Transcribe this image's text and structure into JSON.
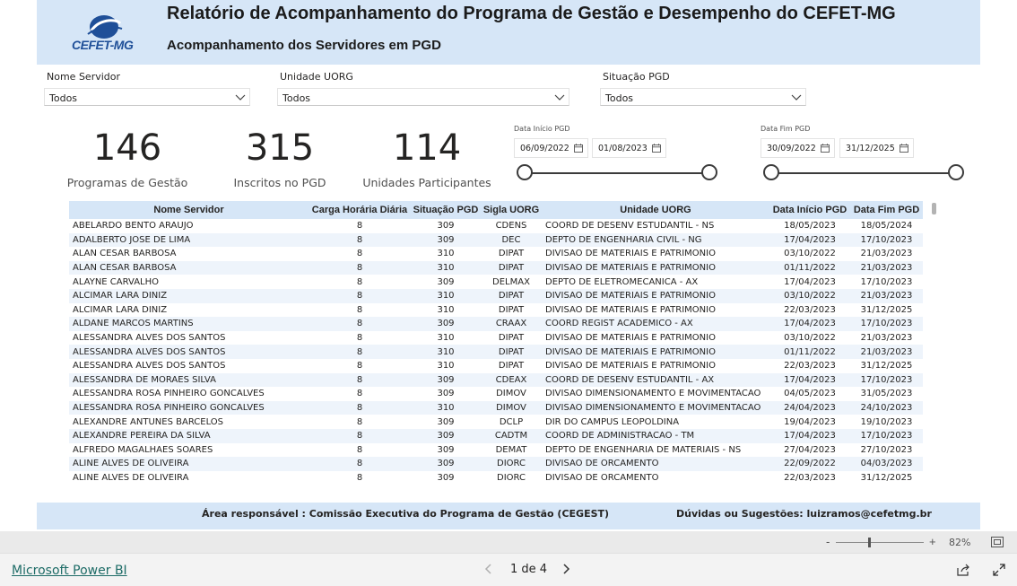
{
  "header": {
    "logo_text": "CEFET-MG",
    "title": "Relatório de Acompanhamento do Programa de Gestão e Desempenho do CEFET-MG",
    "subtitle": "Acompanhamento dos Servidores em PGD",
    "band_color": "#d6e6f7",
    "logo_color": "#1f4f98"
  },
  "filters": [
    {
      "label": "Nome Servidor",
      "value": "Todos"
    },
    {
      "label": "Unidade UORG",
      "value": "Todos"
    },
    {
      "label": "Situação PGD",
      "value": "Todos"
    }
  ],
  "kpis": [
    {
      "value": "146",
      "label": "Programas de Gestão"
    },
    {
      "value": "315",
      "label": "Inscritos no PGD"
    },
    {
      "value": "114",
      "label": "Unidades Participantes"
    }
  ],
  "date_filters": {
    "inicio": {
      "label": "Data Início PGD",
      "from": "06/09/2022",
      "to": "01/08/2023"
    },
    "fim": {
      "label": "Data Fim PGD",
      "from": "30/09/2022",
      "to": "31/12/2025"
    }
  },
  "table": {
    "columns": [
      "Nome Servidor",
      "Carga Horária Diária",
      "Situação PGD",
      "Sigla UORG",
      "Unidade UORG",
      "Data Início PGD",
      "Data Fim PGD"
    ],
    "rows": [
      [
        "ABELARDO BENTO ARAUJO",
        "8",
        "309",
        "CDENS",
        "COORD DE DESENV ESTUDANTIL - NS",
        "18/05/2023",
        "18/05/2024"
      ],
      [
        "ADALBERTO JOSE DE LIMA",
        "8",
        "309",
        "DEC",
        "DEPTO DE ENGENHARIA CIVIL - NG",
        "17/04/2023",
        "17/10/2023"
      ],
      [
        "ALAN CESAR BARBOSA",
        "8",
        "310",
        "DIPAT",
        "DIVISAO DE MATERIAIS E PATRIMONIO",
        "03/10/2022",
        "21/03/2023"
      ],
      [
        "ALAN CESAR BARBOSA",
        "8",
        "310",
        "DIPAT",
        "DIVISAO DE MATERIAIS E PATRIMONIO",
        "01/11/2022",
        "21/03/2023"
      ],
      [
        "ALAYNE CARVALHO",
        "8",
        "309",
        "DELMAX",
        "DEPTO DE ELETROMECANICA - AX",
        "17/04/2023",
        "17/10/2023"
      ],
      [
        "ALCIMAR LARA DINIZ",
        "8",
        "310",
        "DIPAT",
        "DIVISAO DE MATERIAIS E PATRIMONIO",
        "03/10/2022",
        "21/03/2023"
      ],
      [
        "ALCIMAR LARA DINIZ",
        "8",
        "310",
        "DIPAT",
        "DIVISAO DE MATERIAIS E PATRIMONIO",
        "22/03/2023",
        "31/12/2025"
      ],
      [
        "ALDANE MARCOS MARTINS",
        "8",
        "309",
        "CRAAX",
        "COORD REGIST ACADEMICO - AX",
        "17/04/2023",
        "17/10/2023"
      ],
      [
        "ALESSANDRA ALVES DOS SANTOS",
        "8",
        "310",
        "DIPAT",
        "DIVISAO DE MATERIAIS E PATRIMONIO",
        "03/10/2022",
        "21/03/2023"
      ],
      [
        "ALESSANDRA ALVES DOS SANTOS",
        "8",
        "310",
        "DIPAT",
        "DIVISAO DE MATERIAIS E PATRIMONIO",
        "01/11/2022",
        "21/03/2023"
      ],
      [
        "ALESSANDRA ALVES DOS SANTOS",
        "8",
        "310",
        "DIPAT",
        "DIVISAO DE MATERIAIS E PATRIMONIO",
        "22/03/2023",
        "31/12/2025"
      ],
      [
        "ALESSANDRA DE MORAES SILVA",
        "8",
        "309",
        "CDEAX",
        "COORD DE DESENV ESTUDANTIL - AX",
        "17/04/2023",
        "17/10/2023"
      ],
      [
        "ALESSANDRA ROSA PINHEIRO GONCALVES",
        "8",
        "309",
        "DIMOV",
        "DIVISAO DIMENSIONAMENTO E MOVIMENTACAO",
        "04/05/2023",
        "31/05/2023"
      ],
      [
        "ALESSANDRA ROSA PINHEIRO GONCALVES",
        "8",
        "310",
        "DIMOV",
        "DIVISAO DIMENSIONAMENTO E MOVIMENTACAO",
        "24/04/2023",
        "24/10/2023"
      ],
      [
        "ALEXANDRE ANTUNES BARCELOS",
        "8",
        "309",
        "DCLP",
        "DIR DO CAMPUS LEOPOLDINA",
        "19/04/2023",
        "19/10/2023"
      ],
      [
        "ALEXANDRE PEREIRA DA SILVA",
        "8",
        "309",
        "CADTM",
        "COORD DE ADMINISTRACAO - TM",
        "17/04/2023",
        "17/10/2023"
      ],
      [
        "ALFREDO MAGALHAES SOARES",
        "8",
        "309",
        "DEMAT",
        "DEPTO DE ENGENHARIA DE MATERIAIS - NS",
        "27/04/2023",
        "27/10/2023"
      ],
      [
        "ALINE ALVES DE OLIVEIRA",
        "8",
        "309",
        "DIORC",
        "DIVISAO DE ORCAMENTO",
        "22/09/2022",
        "04/03/2023"
      ],
      [
        "ALINE ALVES DE OLIVEIRA",
        "8",
        "309",
        "DIORC",
        "DIVISAO DE ORCAMENTO",
        "22/03/2023",
        "31/12/2025"
      ]
    ]
  },
  "footer": {
    "left": "Área responsável : Comissão Executiva do Programa de Gestão (CEGEST)",
    "right": "Dúvidas ou Sugestões: luizramos@cefetmg.br"
  },
  "zoom": {
    "minus": "-",
    "plus": "+",
    "percent": "82%",
    "level": 0.38
  },
  "bottom_bar": {
    "link": "Microsoft Power BI",
    "page_indicator": "1 de 4",
    "link_color": "#1e6c67"
  },
  "icons": [
    "chevron-down-icon",
    "calendar-icon",
    "chevron-left-icon",
    "chevron-right-icon",
    "share-icon",
    "fullscreen-icon",
    "fit-to-page-icon"
  ]
}
